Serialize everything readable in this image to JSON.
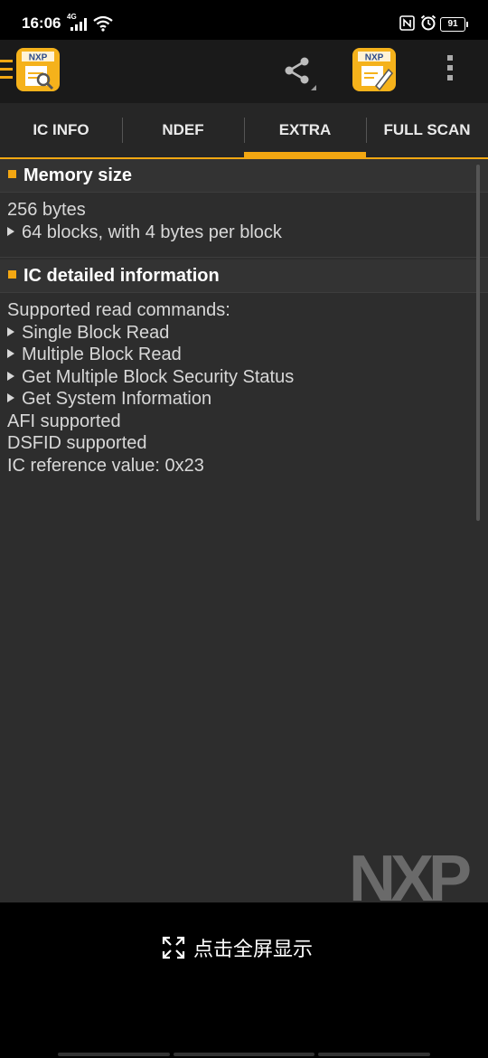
{
  "status_bar": {
    "time": "16:06",
    "network": "4G",
    "battery": "91"
  },
  "app_bar": {
    "logo_text": "NXP"
  },
  "tabs": [
    {
      "label": "IC INFO",
      "active": false
    },
    {
      "label": "NDEF",
      "active": false
    },
    {
      "label": "EXTRA",
      "active": true
    },
    {
      "label": "FULL SCAN",
      "active": false
    }
  ],
  "memory": {
    "title": "Memory size",
    "size": "256 bytes",
    "blocks": "64 blocks, with 4 bytes per block"
  },
  "ic": {
    "title": "IC detailed information",
    "commands_label": "Supported read commands:",
    "commands": [
      "Single Block Read",
      "Multiple Block Read",
      "Get Multiple Block Security Status",
      "Get System Information"
    ],
    "afi": "AFI supported",
    "dsfid": "DSFID supported",
    "reference": "IC reference value: 0x23"
  },
  "watermark": "NXP",
  "bottom": {
    "fullscreen_label": "点击全屏显示"
  },
  "colors": {
    "accent": "#f3a712",
    "background": "#2d2d2d",
    "appbar": "#1a1a1a"
  }
}
